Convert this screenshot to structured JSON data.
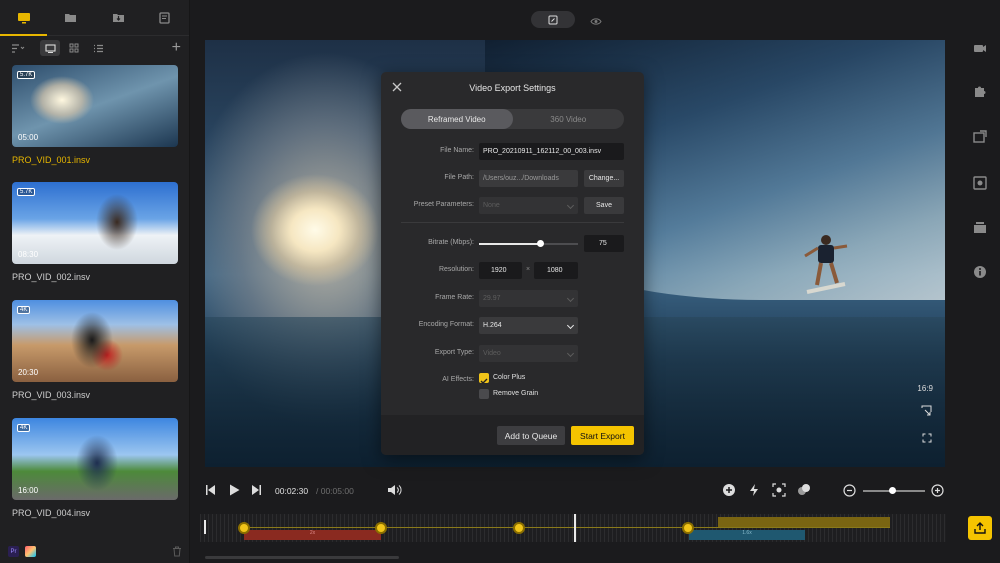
{
  "sidebar": {
    "clips": [
      {
        "name": "PRO_VID_001.insv",
        "res": "5.7K",
        "duration": "05:00",
        "selected": true
      },
      {
        "name": "PRO_VID_002.insv",
        "res": "5.7K",
        "duration": "08:30",
        "selected": false
      },
      {
        "name": "PRO_VID_003.insv",
        "res": "4K",
        "duration": "20:30",
        "selected": false
      },
      {
        "name": "PRO_VID_004.insv",
        "res": "4K",
        "duration": "16:00",
        "selected": false
      }
    ],
    "footer_pr": "Pr"
  },
  "preview": {
    "aspect_ratio": "16:9"
  },
  "modal": {
    "title": "Video Export Settings",
    "tabs": [
      "Reframed Video",
      "360 Video"
    ],
    "active_tab": 0,
    "file_name": {
      "label": "File Name:",
      "value": "PRO_20210911_162112_00_003.insv"
    },
    "file_path": {
      "label": "File Path:",
      "value": "/Users/ouz.../Downloads",
      "button": "Change..."
    },
    "preset": {
      "label": "Preset Parameters:",
      "placeholder": "None",
      "button": "Save"
    },
    "bitrate": {
      "label": "Bitrate (Mbps):",
      "value": "75",
      "slider_fraction": 0.62
    },
    "resolution": {
      "label": "Resolution:",
      "width": "1920",
      "separator": "×",
      "height": "1080"
    },
    "frame_rate": {
      "label": "Frame Rate:",
      "value": "29.97"
    },
    "encoding": {
      "label": "Encoding Format:",
      "value": "H.264"
    },
    "export_type": {
      "label": "Export Type:",
      "value": "Video"
    },
    "ai_effects": {
      "label": "AI Effects:",
      "options": [
        {
          "label": "Color Plus",
          "checked": true
        },
        {
          "label": "Remove Grain",
          "checked": false
        }
      ]
    },
    "add_queue": "Add to Queue",
    "start_export": "Start Export"
  },
  "playback": {
    "current_time": "00:02:30",
    "total_time": "/ 00:05:00",
    "zoom_fraction": 0.48
  },
  "timeline": {
    "red_clip_label": "2x",
    "blue_clip_label": "1.6x"
  },
  "colors": {
    "accent": "#f5c400"
  }
}
